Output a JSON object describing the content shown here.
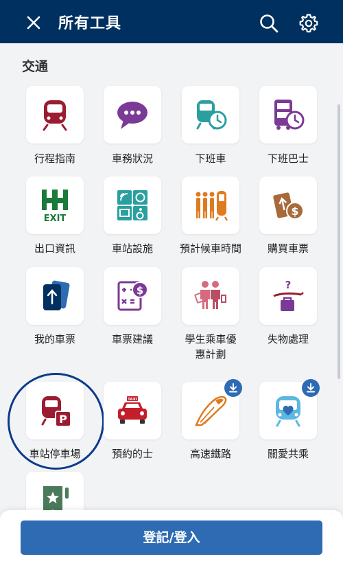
{
  "header": {
    "title": "所有工具",
    "close_icon": "close-icon",
    "search_icon": "search-icon",
    "settings_icon": "gear-icon"
  },
  "section": {
    "title": "交通"
  },
  "tools": [
    {
      "label": "行程指南",
      "icon": "train-icon"
    },
    {
      "label": "車務狀況",
      "icon": "chat-bubble-icon"
    },
    {
      "label": "下班車",
      "icon": "train-clock-icon"
    },
    {
      "label": "下班巴士",
      "icon": "bus-clock-icon"
    },
    {
      "label": "出口資訊",
      "icon": "exit-icon"
    },
    {
      "label": "車站設施",
      "icon": "station-facilities-icon"
    },
    {
      "label": "預計候車時間",
      "icon": "queue-wait-icon"
    },
    {
      "label": "購買車票",
      "icon": "ticket-dollar-icon"
    },
    {
      "label": "我的車票",
      "icon": "my-ticket-icon"
    },
    {
      "label": "車票建議",
      "icon": "calculator-dollar-icon"
    },
    {
      "label": "學生乘車優惠計劃",
      "icon": "students-icon"
    },
    {
      "label": "失物處理",
      "icon": "lost-property-icon"
    },
    {
      "label": "車站停車場",
      "icon": "train-parking-icon"
    },
    {
      "label": "預約的士",
      "icon": "taxi-icon",
      "taxi_sign": "TAXI"
    },
    {
      "label": "高速鐵路",
      "icon": "high-speed-rail-icon"
    },
    {
      "label": "關愛共乘",
      "icon": "caring-train-icon"
    },
    {
      "label": "",
      "icon": "bookmark-star-icon"
    }
  ],
  "exit_sign": "EXIT",
  "footer": {
    "login_label": "登記/登入"
  },
  "colors": {
    "header_bg": "#00305f",
    "primary": "#2e6bb3",
    "mtr_red": "#9b1c31",
    "purple": "#7b3a96",
    "teal": "#2a9fa0",
    "orange": "#e07a1f",
    "green": "#1a7a3a",
    "brown": "#a86a3a"
  }
}
